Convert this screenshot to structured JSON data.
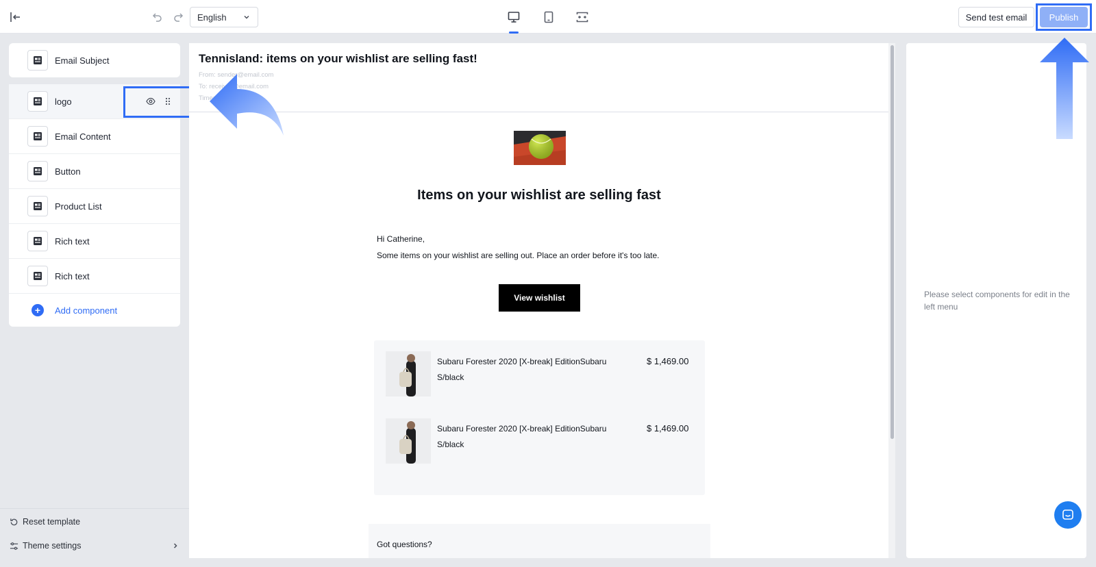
{
  "toolbar": {
    "language": "English",
    "send_test_label": "Send test email",
    "publish_label": "Publish"
  },
  "sidebar": {
    "subject_label": "Email Subject",
    "components": [
      {
        "label": "logo"
      },
      {
        "label": "Email Content"
      },
      {
        "label": "Button"
      },
      {
        "label": "Product List"
      },
      {
        "label": "Rich text"
      },
      {
        "label": "Rich text"
      }
    ],
    "add_label": "Add component",
    "reset_label": "Reset template",
    "theme_label": "Theme settings"
  },
  "email": {
    "subject": "Tennisland: items on your wishlist are selling fast!",
    "from": "From: sender@email.com",
    "to": "To: receiver@email.com",
    "time": "Time:",
    "heading": "Items on your wishlist are selling fast",
    "greeting": "Hi Catherine,",
    "body": "Some items on your wishlist are selling out. Place an order before it's too late.",
    "cta_label": "View wishlist",
    "products": [
      {
        "name": "Subaru Forester 2020 [X-break] EditionSubaru",
        "variant": "S/black",
        "price": "$ 1,469.00"
      },
      {
        "name": "Subaru Forester 2020 [X-break] EditionSubaru",
        "variant": "S/black",
        "price": "$ 1,469.00"
      }
    ],
    "questions": "Got questions?"
  },
  "right_panel": {
    "hint": "Please select components for edit in the left menu"
  },
  "colors": {
    "accent": "#2f6cf5",
    "publish_disabled": "#8fb0f7",
    "chat": "#1f7ef0"
  }
}
